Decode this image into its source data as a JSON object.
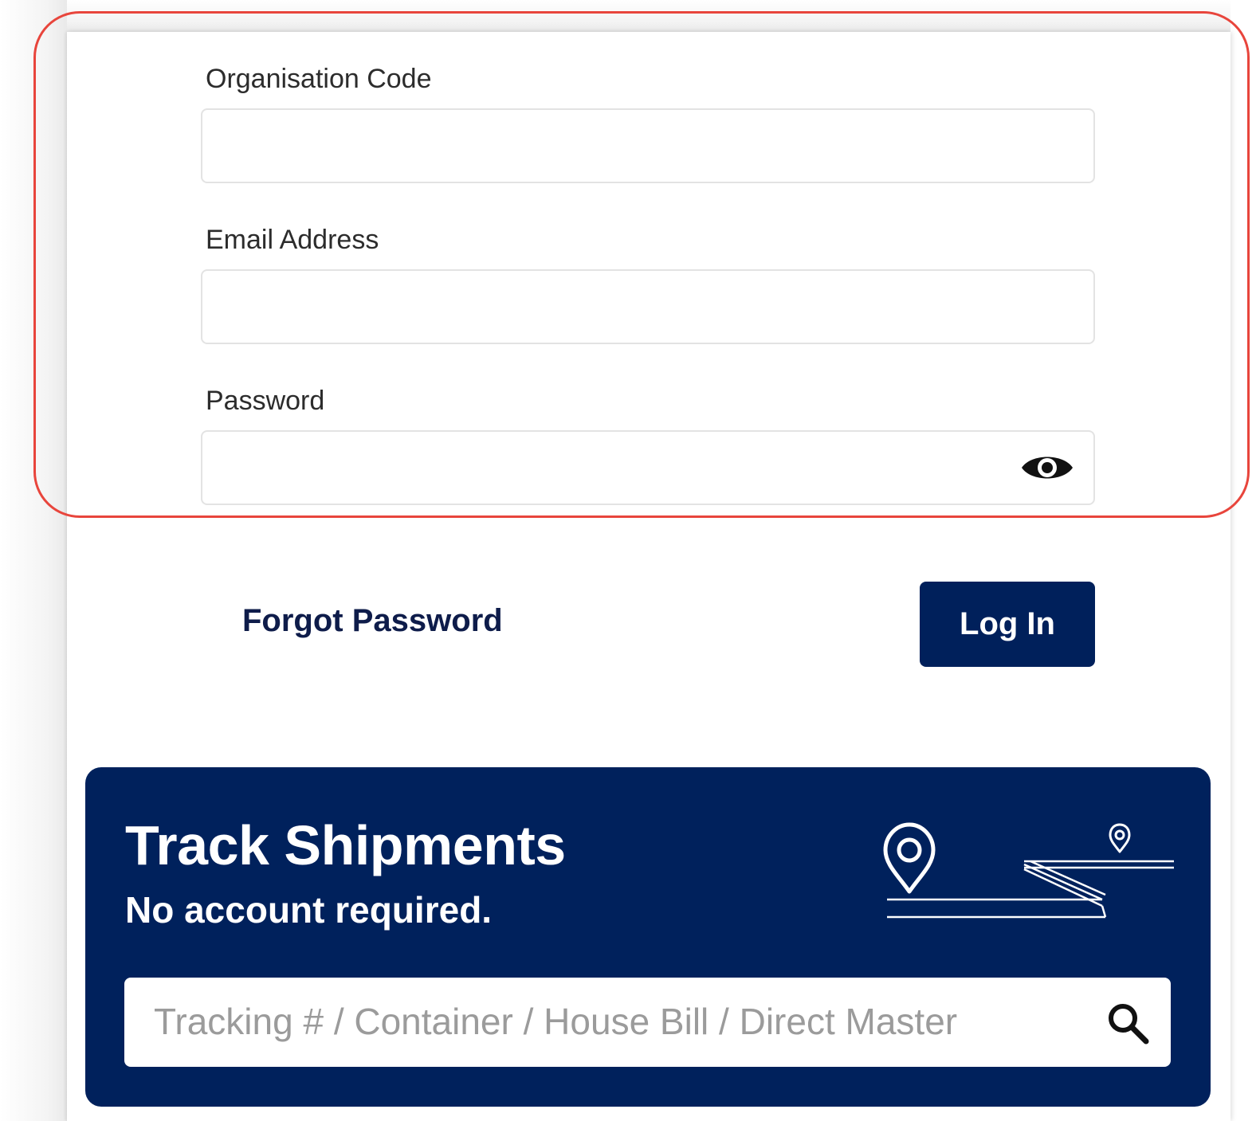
{
  "login_form": {
    "organisation_code": {
      "label": "Organisation Code",
      "value": ""
    },
    "email_address": {
      "label": "Email Address",
      "value": ""
    },
    "password": {
      "label": "Password",
      "value": "",
      "toggle_icon": "eye-icon"
    },
    "forgot_password_label": "Forgot Password",
    "login_button_label": "Log In"
  },
  "track_shipments": {
    "title": "Track Shipments",
    "subtitle": "No account required.",
    "search_placeholder": "Tracking # / Container / House Bill / Direct Master",
    "search_icon": "search-icon",
    "illustration_icon": "map-route-icon"
  },
  "colors": {
    "brand_navy": "#00215c",
    "highlight_red": "#e8453c",
    "link_text": "#0e1c4a"
  }
}
